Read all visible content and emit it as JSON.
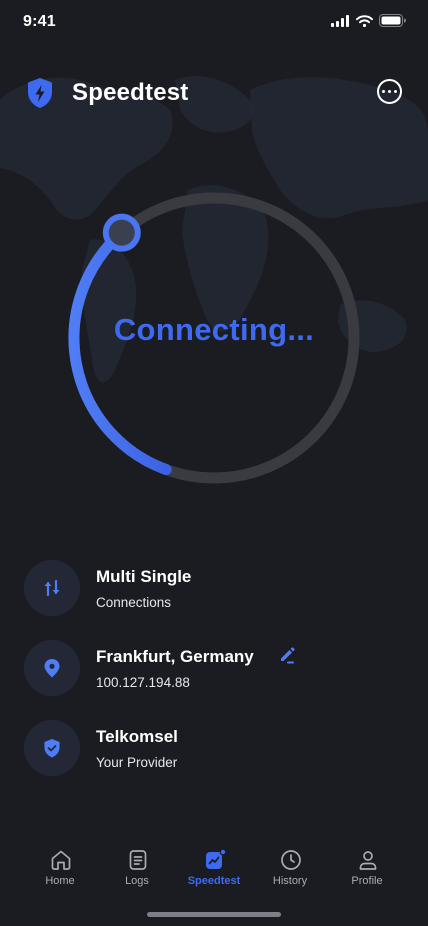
{
  "status_bar": {
    "time": "9:41",
    "icons": [
      "cellular-signal-icon",
      "wifi-icon",
      "battery-icon"
    ]
  },
  "header": {
    "title": "Speedtest",
    "logo_icon": "shield-bolt-icon",
    "menu_icon": "more-horizontal-icon"
  },
  "gauge": {
    "status_text": "Connecting...",
    "progress": 0.33
  },
  "info": {
    "connection": {
      "title": "Multi Single",
      "subtitle": "Connections",
      "icon": "up-down-arrows-icon"
    },
    "server": {
      "title": "Frankfurt, Germany",
      "subtitle": "100.127.194.88",
      "icon": "location-pin-icon",
      "action_icon": "edit-pencil-icon"
    },
    "provider": {
      "title": "Telkomsel",
      "subtitle": "Your Provider",
      "icon": "shield-check-icon"
    }
  },
  "tabs": [
    {
      "label": "Home",
      "icon": "home-icon",
      "active": false
    },
    {
      "label": "Logs",
      "icon": "document-icon",
      "active": false
    },
    {
      "label": "Speedtest",
      "icon": "speedtest-chart-icon",
      "active": true
    },
    {
      "label": "History",
      "icon": "clock-icon",
      "active": false
    },
    {
      "label": "Profile",
      "icon": "user-icon",
      "active": false
    }
  ],
  "colors": {
    "background": "#1b1c22",
    "accent": "#3d6af0",
    "icon_circle": "#242736",
    "track": "#3a3b41",
    "inactive": "#a9abb4"
  }
}
